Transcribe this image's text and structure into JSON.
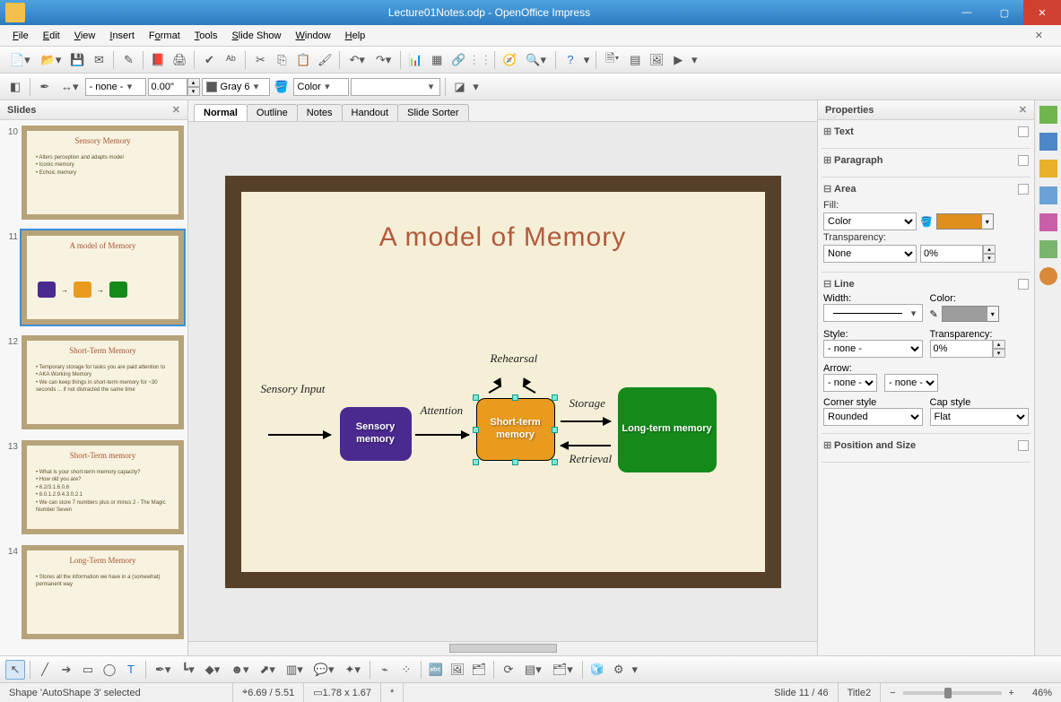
{
  "window": {
    "title": "Lecture01Notes.odp - OpenOffice Impress",
    "min_glyph": "—",
    "max_glyph": "▢",
    "close_glyph": "✕"
  },
  "menu": {
    "items": [
      "File",
      "Edit",
      "View",
      "Insert",
      "Format",
      "Tools",
      "Slide Show",
      "Window",
      "Help"
    ],
    "close_glyph": "✕"
  },
  "toolbar2": {
    "linestyle": "- none -",
    "width": "0.00\"",
    "colorname": "Gray 6",
    "fillmode": "Color"
  },
  "slidespanel": {
    "title": "Slides",
    "items": [
      {
        "num": "10",
        "title": "Sensory Memory",
        "lines": [
          "Alters perception and adapts model",
          "Iconic memory",
          "Echoic memory"
        ]
      },
      {
        "num": "11",
        "title": "A model of Memory",
        "diagram": true
      },
      {
        "num": "12",
        "title": "Short-Term Memory",
        "lines": [
          "Temporary storage for tasks you are paid attention to",
          "AKA Working Memory",
          "We can keep things in short-term memory for ~30 seconds ... if not distracted the same time"
        ]
      },
      {
        "num": "13",
        "title": "Short-Term memory",
        "lines": [
          "What is your short-term memory capacity?",
          "How old you are?",
          "6.2/3.1.6.0.6",
          "8.0.1.2.9.4.3.0.2.1",
          "We can store 7 numbers plus or minus 2 - The Magic Number Seven"
        ]
      },
      {
        "num": "14",
        "title": "Long-Term Memory",
        "lines": [
          "Stores all the information we have in a (somewhat) permanent way"
        ]
      }
    ],
    "selected": "11"
  },
  "viewtabs": [
    "Normal",
    "Outline",
    "Notes",
    "Handout",
    "Slide Sorter"
  ],
  "viewtab_active": "Normal",
  "slide": {
    "title": "A model of Memory",
    "sensory_input": "Sensory Input",
    "attention": "Attention",
    "rehearsal": "Rehearsal",
    "storage": "Storage",
    "retrieval": "Retrieval",
    "box_sensory": "Sensory memory",
    "box_short": "Short-term memory",
    "box_long": "Long-term memory"
  },
  "properties": {
    "title": "Properties",
    "sections": {
      "text": "Text",
      "paragraph": "Paragraph",
      "area": "Area",
      "line": "Line",
      "pos": "Position and Size"
    },
    "area": {
      "fill_label": "Fill:",
      "fill_mode": "Color",
      "transparency_label": "Transparency:",
      "transparency_mode": "None",
      "transparency_value": "0%"
    },
    "line": {
      "width_label": "Width:",
      "color_label": "Color:",
      "style_label": "Style:",
      "style_value": "- none -",
      "transparency_label": "Transparency:",
      "transparency_value": "0%",
      "arrow_label": "Arrow:",
      "arrow_left": "- none -",
      "arrow_right": "- none -",
      "corner_label": "Corner style",
      "corner_value": "Rounded",
      "cap_label": "Cap style",
      "cap_value": "Flat"
    }
  },
  "status": {
    "selection": "Shape 'AutoShape 3' selected",
    "pos": "6.69 / 5.51",
    "size": "1.78 x 1.67",
    "modified": "*",
    "slide": "Slide 11 / 46",
    "master": "Title2",
    "zoom": "46%"
  }
}
